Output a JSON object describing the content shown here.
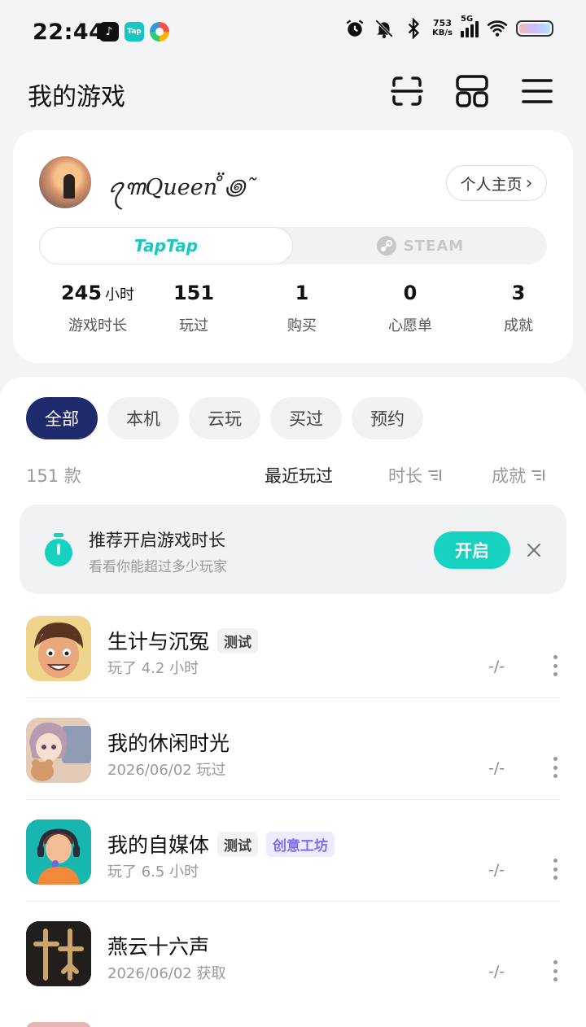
{
  "status_bar": {
    "time": "22:44",
    "speed_value": "753",
    "speed_unit": "KB/s",
    "network": "5G",
    "apps": [
      "tiktok-icon",
      "taptap-icon",
      "color-app-icon"
    ],
    "tap_label": "Tap",
    "tiktok_glyph": "♪"
  },
  "header": {
    "title": "我的游戏"
  },
  "profile": {
    "username": "ꪖ꧑Queen ̊̈꩜˜",
    "profile_link": "个人主页",
    "profile_link_arrow": "›",
    "platforms": {
      "taptap": "TapTap",
      "steam": "STEAM"
    },
    "stats": [
      {
        "value": "245",
        "unit": "小时",
        "label": "游戏时长"
      },
      {
        "value": "151",
        "unit": "",
        "label": "玩过"
      },
      {
        "value": "1",
        "unit": "",
        "label": "购买"
      },
      {
        "value": "0",
        "unit": "",
        "label": "心愿单"
      },
      {
        "value": "3",
        "unit": "",
        "label": "成就"
      }
    ]
  },
  "filters": [
    "全部",
    "本机",
    "云玩",
    "买过",
    "预约"
  ],
  "list_header": {
    "count": "151 款",
    "sorts": [
      "最近玩过",
      "时长",
      "成就"
    ]
  },
  "banner": {
    "title": "推荐开启游戏时长",
    "subtitle": "看看你能超过多少玩家",
    "button": "开启"
  },
  "games": [
    {
      "name": "生计与沉冤",
      "tags": [
        "测试"
      ],
      "sub": "玩了 4.2 小时",
      "score": "-/-"
    },
    {
      "name": "我的休闲时光",
      "tags": [],
      "sub": "2026/06/02 玩过",
      "score": "-/-"
    },
    {
      "name": "我的自媒体",
      "tags": [
        "测试",
        "创意工坊"
      ],
      "sub": "玩了 6.5 小时",
      "score": "-/-"
    },
    {
      "name": "燕云十六声",
      "tags": [],
      "sub": "2026/06/02 获取",
      "score": "-/-"
    }
  ],
  "colors": {
    "accent_teal": "#16d2c0",
    "chip_active": "#1f2b6c",
    "tag_purple": "#7c6cf0"
  }
}
